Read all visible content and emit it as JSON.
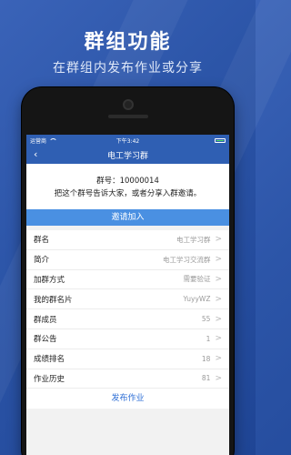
{
  "promo": {
    "title": "群组功能",
    "subtitle": "在群组内发布作业或分享"
  },
  "status_bar": {
    "carrier": "运营商",
    "time": "下午3:42"
  },
  "nav": {
    "back_icon": "‹",
    "title": "电工学习群"
  },
  "group_info": {
    "number_line": "群号：10000014",
    "hint": "把这个群号告诉大家，或者分享入群邀请。"
  },
  "invite_button": "邀请加入",
  "rows": [
    {
      "label": "群名",
      "value": "电工学习群"
    },
    {
      "label": "简介",
      "value": "电工学习交流群"
    },
    {
      "label": "加群方式",
      "value": "需要验证"
    },
    {
      "label": "我的群名片",
      "value": "YuyyWZ"
    },
    {
      "label": "群成员",
      "value": "55"
    },
    {
      "label": "群公告",
      "value": "1"
    },
    {
      "label": "成绩排名",
      "value": "18"
    },
    {
      "label": "作业历史",
      "value": "81"
    }
  ],
  "chevron": ">",
  "publish_button": "发布作业",
  "colors": {
    "navbar": "#2f5fb3",
    "invite": "#4a90e2",
    "publish_text": "#2f6fd6",
    "background": "#2c55a8"
  }
}
